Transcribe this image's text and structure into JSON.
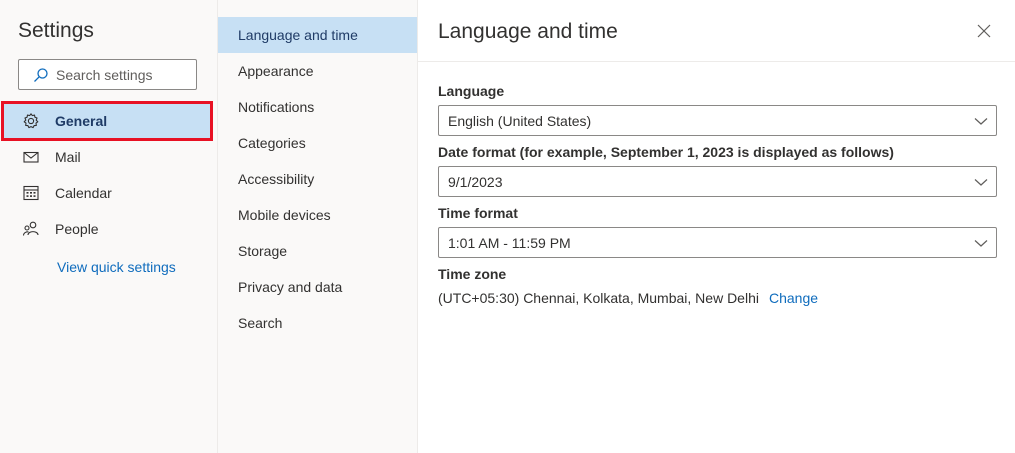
{
  "settings_nav": {
    "title": "Settings",
    "search": {
      "placeholder": "Search settings",
      "icon": "search-icon"
    },
    "items": [
      {
        "label": "General",
        "icon": "gear-icon",
        "selected": true
      },
      {
        "label": "Mail",
        "icon": "mail-icon",
        "selected": false
      },
      {
        "label": "Calendar",
        "icon": "calendar-icon",
        "selected": false
      },
      {
        "label": "People",
        "icon": "people-icon",
        "selected": false
      }
    ],
    "quick_settings_link": "View quick settings"
  },
  "general_nav": {
    "items": [
      {
        "label": "Language and time",
        "selected": true
      },
      {
        "label": "Appearance",
        "selected": false
      },
      {
        "label": "Notifications",
        "selected": false
      },
      {
        "label": "Categories",
        "selected": false
      },
      {
        "label": "Accessibility",
        "selected": false
      },
      {
        "label": "Mobile devices",
        "selected": false
      },
      {
        "label": "Storage",
        "selected": false
      },
      {
        "label": "Privacy and data",
        "selected": false
      },
      {
        "label": "Search",
        "selected": false
      }
    ]
  },
  "content": {
    "title": "Language and time",
    "language": {
      "label": "Language",
      "value": "English (United States)"
    },
    "date_format": {
      "label": "Date format (for example, September 1, 2023 is displayed as follows)",
      "value": "9/1/2023"
    },
    "time_format": {
      "label": "Time format",
      "value": "1:01 AM - 11:59 PM"
    },
    "time_zone": {
      "label": "Time zone",
      "value": "(UTC+05:30) Chennai, Kolkata, Mumbai, New Delhi",
      "change_link": "Change"
    }
  },
  "colors": {
    "accent": "#0f6cbd",
    "selected_bg": "#c7e0f4",
    "highlight_border": "#e81123"
  }
}
